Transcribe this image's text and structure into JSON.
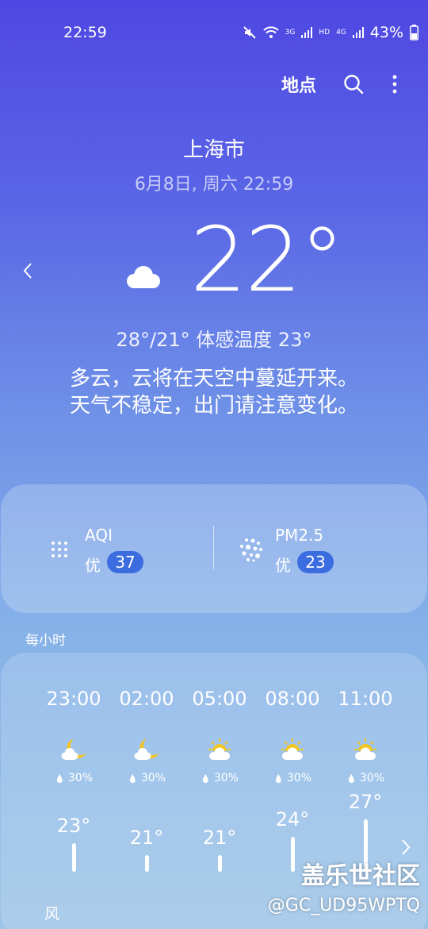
{
  "status_bar": {
    "time": "22:59",
    "net_3g": "3G",
    "hd": "HD",
    "net_4g": "4G",
    "battery": "43%"
  },
  "header": {
    "location_button": "地点"
  },
  "city": "上海市",
  "datetime": "6月8日, 周六 22:59",
  "current": {
    "temperature": "22°",
    "hi_lo_feels": "28°/21° 体感温度 23°",
    "description_line1": "多云，云将在天空中蔓延开来。",
    "description_line2": "天气不稳定，出门请注意变化。",
    "icon": "partly-cloudy-night-icon"
  },
  "air": {
    "aqi": {
      "label": "AQI",
      "grade": "优",
      "value": "37"
    },
    "pm25": {
      "label": "PM2.5",
      "grade": "优",
      "value": "23"
    }
  },
  "hourly": {
    "title": "每小时",
    "wind_label": "风",
    "items": [
      {
        "time": "23:00",
        "icon": "moon-cloud-icon",
        "rain": "30%",
        "temp": "23°",
        "temp_value": 23
      },
      {
        "time": "02:00",
        "icon": "moon-cloud-icon",
        "rain": "30%",
        "temp": "21°",
        "temp_value": 21
      },
      {
        "time": "05:00",
        "icon": "sun-cloud-icon",
        "rain": "30%",
        "temp": "21°",
        "temp_value": 21
      },
      {
        "time": "08:00",
        "icon": "sun-cloud-icon",
        "rain": "30%",
        "temp": "24°",
        "temp_value": 24
      },
      {
        "time": "11:00",
        "icon": "sun-cloud-icon",
        "rain": "30%",
        "temp": "27°",
        "temp_value": 27
      }
    ]
  },
  "watermark": {
    "line1": "盖乐世社区",
    "line2": "@GC_UD95WPTQ"
  },
  "colors": {
    "background_top": "#4f47e2",
    "background_bottom": "#9cc4e6",
    "aqi_badge": "#3c6de0",
    "moon": "#f3c623"
  }
}
